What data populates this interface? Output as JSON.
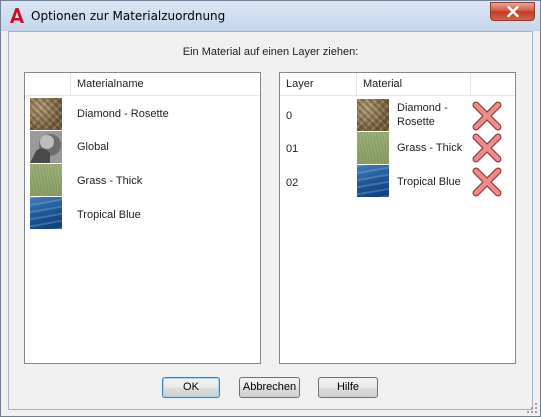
{
  "window": {
    "title": "Optionen zur Materialzuordnung",
    "close_icon": "close-icon",
    "app_icon": "autocad-a-icon"
  },
  "instruction": "Ein Material auf einen Layer ziehen:",
  "materials_list": {
    "column_header": "Materialname",
    "items": [
      {
        "name": "Diamond - Rosette",
        "texture": "diamond"
      },
      {
        "name": "Global",
        "texture": "global"
      },
      {
        "name": "Grass - Thick",
        "texture": "grass"
      },
      {
        "name": "Tropical Blue",
        "texture": "blue"
      }
    ]
  },
  "layer_list": {
    "column_headers": {
      "layer": "Layer",
      "material": "Material"
    },
    "rows": [
      {
        "layer": "0",
        "material_line1": "Diamond -",
        "material_line2": "Rosette",
        "texture": "diamond",
        "delete_icon": "red-x-delete-icon"
      },
      {
        "layer": "01",
        "material_line1": "Grass - Thick",
        "material_line2": "",
        "texture": "grass",
        "delete_icon": "red-x-delete-icon"
      },
      {
        "layer": "02",
        "material_line1": "Tropical Blue",
        "material_line2": "",
        "texture": "blue",
        "delete_icon": "red-x-delete-icon"
      }
    ]
  },
  "buttons": {
    "ok": "OK",
    "cancel": "Abbrechen",
    "help": "Hilfe"
  },
  "colors": {
    "close_button": "#c9442c",
    "delete_x": "#e08080",
    "selected_default_border": "#3c7fb1"
  }
}
